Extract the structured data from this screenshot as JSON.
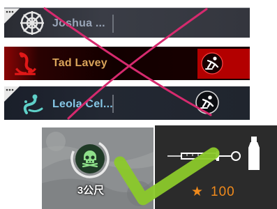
{
  "players": [
    {
      "name": "Joshua ...",
      "emblem": "ship-wheel-icon",
      "has_chat_badge": true,
      "status": null
    },
    {
      "name": "Tad Lavey",
      "emblem": "anchor-swirl-icon",
      "has_chat_badge": false,
      "status": "knocked-down-icon"
    },
    {
      "name": "Leola Cel...",
      "emblem": "serpent-icon",
      "has_chat_badge": true,
      "status": "knocked-down-icon"
    }
  ],
  "marker": {
    "icon": "skull-icon",
    "distance": "3公尺"
  },
  "item": {
    "art": [
      "syringe-icon",
      "bottle-icon"
    ],
    "price": "100",
    "price_icon": "star-icon"
  },
  "annotations": {
    "strike_color": "#d62a6e",
    "check_color": "#8bc92a"
  },
  "colors": {
    "downed_red": "#b30000",
    "price_orange": "#f08a1c"
  }
}
